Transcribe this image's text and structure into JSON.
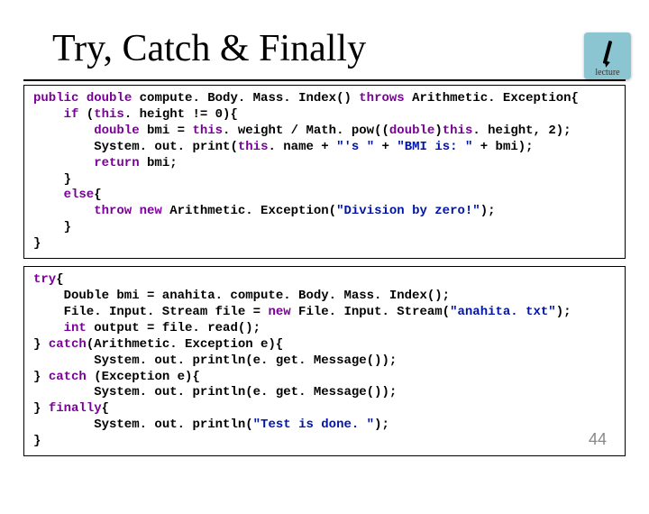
{
  "logo": {
    "text": "lecture"
  },
  "title": "Try, Catch & Finally",
  "code1": {
    "l0a": "public",
    "l0b": " double",
    "l0c": " compute. Body. Mass. Index() ",
    "l0d": "throws",
    "l0e": " Arithmetic. Exception{",
    "l1a": "if",
    "l1b": " (",
    "l1c": "this",
    "l1d": ". height != 0){",
    "l2a": "double",
    "l2b": " bmi = ",
    "l2c": "this",
    "l2d": ". weight / Math. ",
    "l2e": "pow",
    "l2f": "((",
    "l2g": "double",
    "l2h": ")",
    "l2i": "this",
    "l2j": ". height, 2);",
    "l3a": "System. ",
    "l3b": "out",
    "l3c": ". print(",
    "l3d": "this",
    "l3e": ". name + ",
    "l3f": "\"'s \"",
    "l3g": " + ",
    "l3h": "\"BMI is: \"",
    "l3i": " + bmi);",
    "l4a": "return",
    "l4b": " bmi;",
    "l5": "}",
    "l6a": "else",
    "l6b": "{",
    "l7a": "throw new",
    "l7b": " Arithmetic. Exception(",
    "l7c": "\"Division by zero!\"",
    "l7d": ");",
    "l8": "}",
    "l9": "}"
  },
  "code2": {
    "l0a": "try",
    "l0b": "{",
    "l1a": "Double bmi = anahita. compute. Body. Mass. Index();",
    "l2a": "File. Input. Stream file = ",
    "l2b": "new",
    "l2c": " File. Input. Stream(",
    "l2d": "\"anahita. txt\"",
    "l2e": ");",
    "l3a": "int",
    "l3b": " output = file. read();",
    "l4a": "} ",
    "l4b": "catch",
    "l4c": "(Arithmetic. Exception e){",
    "l5a": "System. ",
    "l5b": "out",
    "l5c": ". println(e. get. Message());",
    "l6a": "} ",
    "l6b": "catch",
    "l6c": " (Exception e){",
    "l7a": "System. ",
    "l7b": "out",
    "l7c": ". println(e. get. Message());",
    "l8a": "} ",
    "l8b": "finally",
    "l8c": "{",
    "l9a": "System. ",
    "l9b": "out",
    "l9c": ". println(",
    "l9d": "\"Test is done. \"",
    "l9e": ");",
    "l10": "}"
  },
  "slide_number": "44"
}
